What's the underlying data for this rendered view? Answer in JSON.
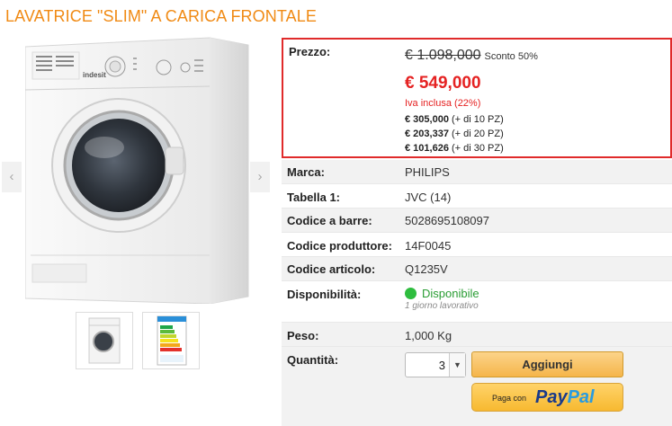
{
  "title": "LAVATRICE \"SLIM\" A CARICA FRONTALE",
  "gallery": {
    "prev_icon": "‹",
    "next_icon": "›",
    "thumbnails": [
      "washer-thumbnail",
      "energy-label-thumbnail"
    ]
  },
  "washer_brand": "indesit",
  "price": {
    "label": "Prezzo:",
    "old_price": "€ 1.098,000",
    "discount": "Sconto 50%",
    "new_price": "€ 549,000",
    "vat": "Iva inclusa (22%)",
    "tiers": [
      {
        "price": "€ 305,000",
        "qty": "(+ di 10 PZ)"
      },
      {
        "price": "€ 203,337",
        "qty": "(+ di 20 PZ)"
      },
      {
        "price": "€ 101,626",
        "qty": "(+ di 30 PZ)"
      }
    ]
  },
  "specs": [
    {
      "key": "Marca:",
      "value": "PHILIPS"
    },
    {
      "key": "Tabella 1:",
      "value": "JVC (14)"
    },
    {
      "key": "Codice a barre:",
      "value": "5028695108097"
    },
    {
      "key": "Codice produttore:",
      "value": "14F0045"
    },
    {
      "key": "Codice articolo:",
      "value": "Q1235V"
    }
  ],
  "availability": {
    "key": "Disponibilità:",
    "value": "Disponibile",
    "sub": "1 giorno lavorativo"
  },
  "weight": {
    "key": "Peso:",
    "value": "1,000 Kg"
  },
  "quantity": {
    "key": "Quantità:",
    "value": "3",
    "arrow": "▼"
  },
  "buttons": {
    "add": "Aggiungi",
    "paypal_prefix": "Paga con",
    "paypal_pay": "Pay",
    "paypal_pal": "Pal"
  },
  "colors": {
    "accent": "#f08a14",
    "price_red": "#e52222",
    "available_green": "#2ebd3e"
  }
}
